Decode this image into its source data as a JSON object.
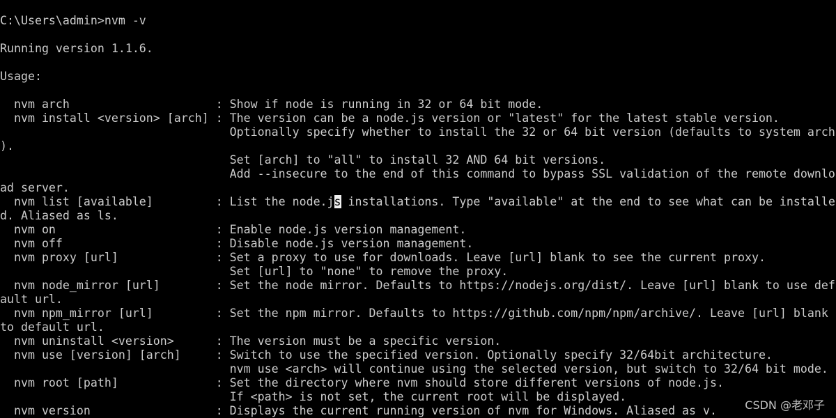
{
  "terminal": {
    "background": "#000000",
    "foreground": "#cccccc",
    "lines": [
      "C:\\Users\\admin>nvm -v",
      "",
      "Running version 1.1.6.",
      "",
      "Usage:",
      "",
      "  nvm arch                     : Show if node is running in 32 or 64 bit mode.",
      "  nvm install <version> [arch] : The version can be a node.js version or \"latest\" for the latest stable version.",
      "                                 Optionally specify whether to install the 32 or 64 bit version (defaults to system arch",
      ").",
      "                                 Set [arch] to \"all\" to install 32 AND 64 bit versions.",
      "                                 Add --insecure to the end of this command to bypass SSL validation of the remote downlo",
      "ad server.",
      "  nvm list [available]         : List the node.js installations. Type \"available\" at the end to see what can be installe",
      "d. Aliased as ls.",
      "  nvm on                       : Enable node.js version management.",
      "  nvm off                      : Disable node.js version management.",
      "  nvm proxy [url]              : Set a proxy to use for downloads. Leave [url] blank to see the current proxy.",
      "                                 Set [url] to \"none\" to remove the proxy.",
      "  nvm node_mirror [url]        : Set the node mirror. Defaults to https://nodejs.org/dist/. Leave [url] blank to use def",
      "ault url.",
      "  nvm npm_mirror [url]         : Set the npm mirror. Defaults to https://github.com/npm/npm/archive/. Leave [url] blank",
      "to default url.",
      "  nvm uninstall <version>      : The version must be a specific version.",
      "  nvm use [version] [arch]     : Switch to use the specified version. Optionally specify 32/64bit architecture.",
      "                                 nvm use <arch> will continue using the selected version, but switch to 32/64 bit mode.",
      "  nvm root [path]              : Set the directory where nvm should store different versions of node.js.",
      "                                 If <path> is not set, the current root will be displayed.",
      "  nvm version                  : Displays the current running version of nvm for Windows. Aliased as v."
    ],
    "cursor": {
      "line": 13,
      "column": 48
    }
  },
  "watermark": {
    "text": "CSDN @老邓子"
  }
}
